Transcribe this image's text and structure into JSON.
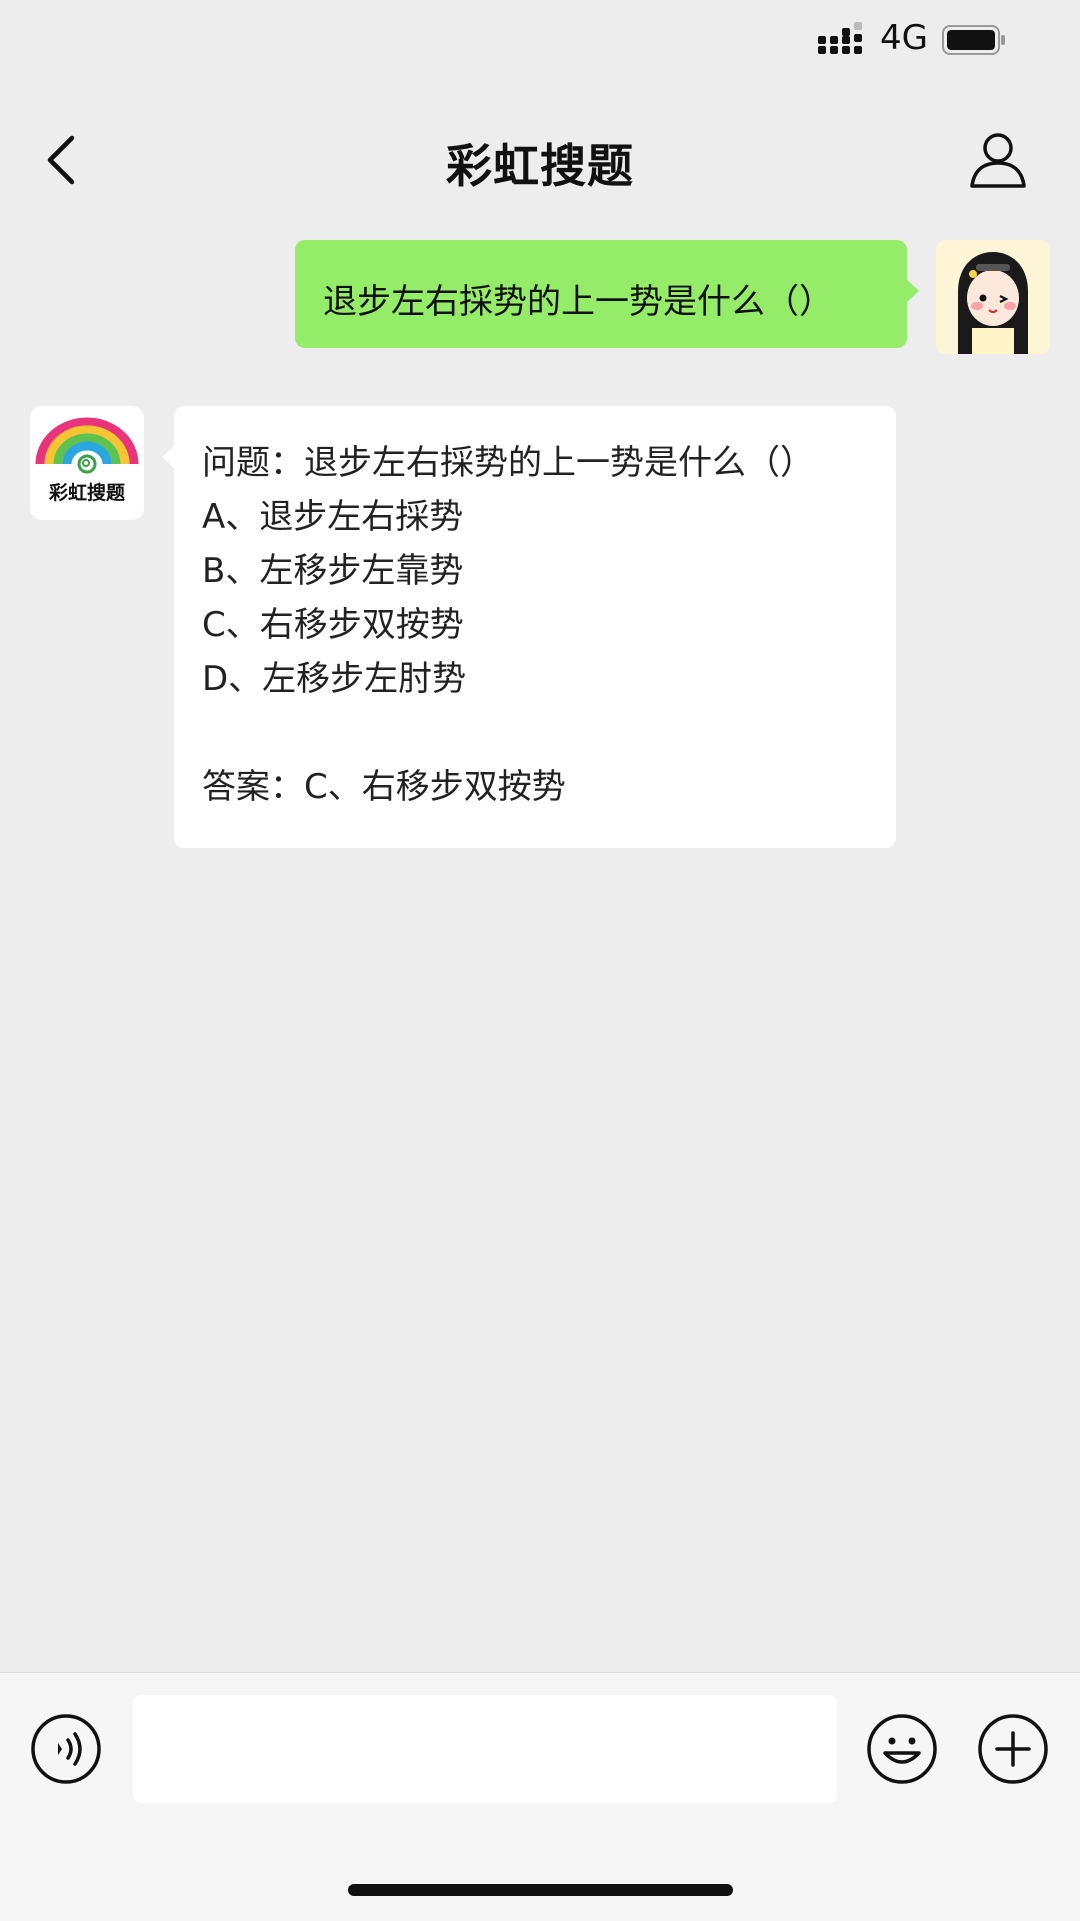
{
  "status_bar": {
    "network": "4G",
    "icons": [
      "signal-icon",
      "battery-icon"
    ]
  },
  "nav": {
    "title": "彩虹搜题",
    "left_icon": "back-chevron-icon",
    "right_icon": "person-icon"
  },
  "chat": {
    "outgoing": {
      "text": "退步左右採势的上一势是什么（）"
    },
    "incoming": {
      "bot_name": "彩虹搜题",
      "question": "问题：退步左右採势的上一势是什么（）",
      "options": [
        "A、退步左右採势",
        "B、左移步左靠势",
        "C、右移步双按势",
        "D、左移步左肘势"
      ],
      "answer": "答案：C、右移步双按势"
    }
  },
  "input_bar": {
    "value": "",
    "icons": [
      "voice-icon",
      "emoji-icon",
      "plus-icon"
    ]
  }
}
